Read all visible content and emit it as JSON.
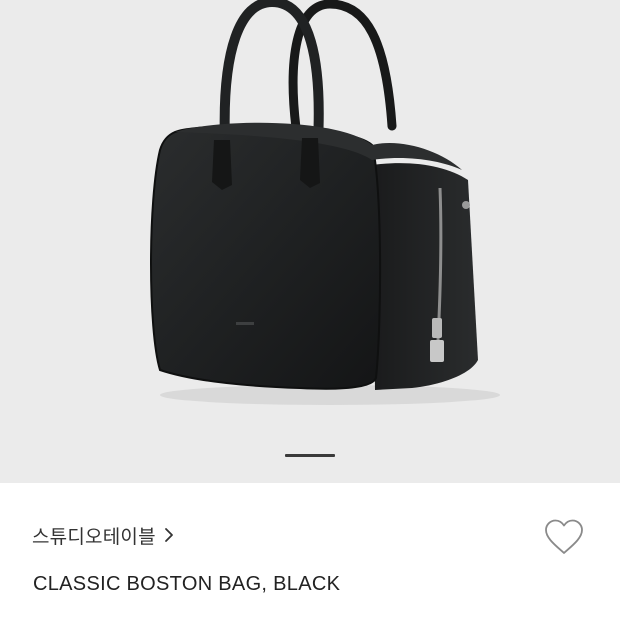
{
  "gallery": {
    "image_alt": "black leather boston bag",
    "slide_indicator": "active"
  },
  "product": {
    "brand": "스튜디오테이블",
    "title": "CLASSIC BOSTON BAG, BLACK"
  },
  "icons": {
    "brand_chevron": "chevron-right-icon",
    "wishlist": "heart-outline-icon"
  }
}
